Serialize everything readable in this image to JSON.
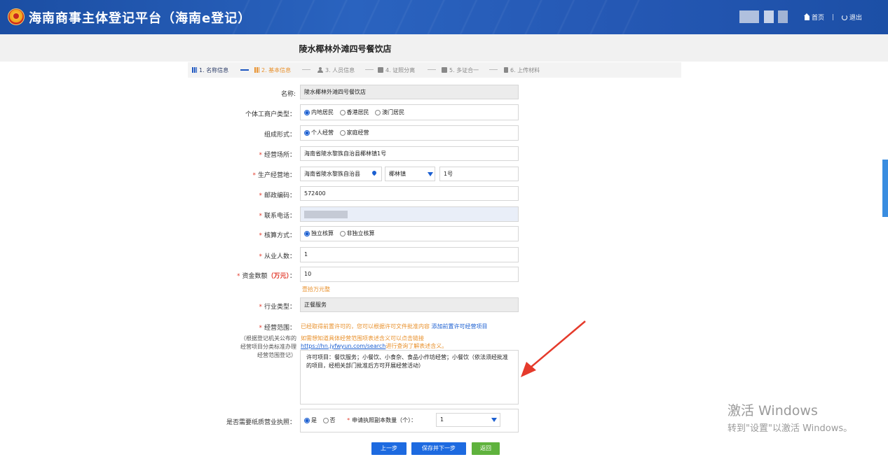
{
  "header": {
    "app_title": "海南商事主体登记平台（海南e登记）",
    "home_label": "首页",
    "separator": "|",
    "logout_label": "退出"
  },
  "page": {
    "store_title": "陵水椰林外滩四号餐饮店"
  },
  "steps": [
    {
      "label": "1. 名称信息",
      "state": "done"
    },
    {
      "label": "2. 基本信息",
      "state": "active"
    },
    {
      "label": "3. 人员信息",
      "state": "todo"
    },
    {
      "label": "4. 证照分离",
      "state": "todo"
    },
    {
      "label": "5. 多证合一",
      "state": "todo"
    },
    {
      "label": "6. 上传材料",
      "state": "todo"
    }
  ],
  "form": {
    "name_label": "名称:",
    "name_value": "陵水椰林外滩四号餐饮店",
    "household_type_label": "个体工商户类型：",
    "household_options": [
      "内地居民",
      "香港居民",
      "澳门居民"
    ],
    "composition_label": "组成形式：",
    "composition_options": [
      "个人经营",
      "家庭经营"
    ],
    "premises_label": "经营场所：",
    "premises_value": "海南省陵水黎族自治县椰林镇1号",
    "production_label": "生产经营地：",
    "production_region": "海南省陵水黎族自治县",
    "production_town": "椰林镇",
    "production_detail": "1号",
    "postal_label": "邮政编码：",
    "postal_value": "572400",
    "phone_label": "联系电话：",
    "accounting_label": "核算方式：",
    "accounting_options": [
      "独立核算",
      "非独立核算"
    ],
    "employees_label": "从业人数：",
    "employees_value": "1",
    "capital_label_prefix": "资金数额",
    "capital_label_unit": "（万元）",
    "capital_label_suffix": "：",
    "capital_value": "10",
    "capital_hint": "壹拾万元整",
    "industry_label": "行业类型：",
    "industry_value": "正餐服务",
    "scope_label": "经营范围：",
    "scope_notice": "已经取得前置许可的，您可以根据许可文件批准内容",
    "scope_add_link": "添加前置许可经营项目",
    "scope_side_note": "（根据登记机关公布的经营项目分类标准办理经营范围登记）",
    "scope_hint_line1": "如需想知道具体经营范围项表述含义可以点击链接",
    "scope_url": "https://hn.jyfwyun.com/search",
    "scope_hint_tail": "进行查询了解表述含义。",
    "scope_text": "许可项目：餐饮服务；小餐饮、小食杂、食品小作坊经营；小餐饮（依法须经批准的项目，经相关部门批准后方可开展经营活动）",
    "paper_license_label": "是否需要纸质营业执照：",
    "paper_options": [
      "是",
      "否"
    ],
    "copies_label": "申请执照副本数量（个）：",
    "copies_value": "1",
    "required_mark": "*"
  },
  "buttons": {
    "prev": "上一步",
    "save_next": "保存并下一步",
    "back": "返回"
  },
  "watermark": {
    "line1": "激活 Windows",
    "line2": "转到\"设置\"以激活 Windows。"
  },
  "colors": {
    "header_blue": "#1b4ea3",
    "accent_blue": "#1d6ae0",
    "required_red": "#e23c2e",
    "hint_orange": "#e8912d",
    "back_green": "#5fb23d"
  }
}
